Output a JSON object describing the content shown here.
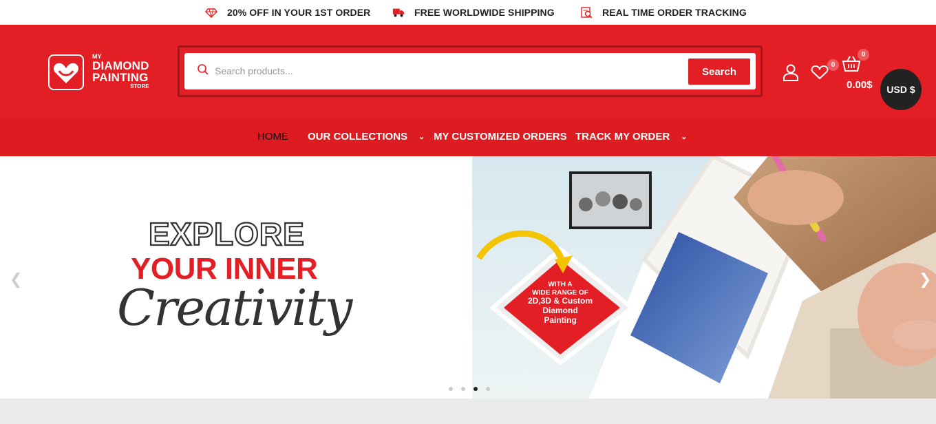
{
  "promos": [
    {
      "icon": "diamond-icon",
      "text": "20% OFF IN YOUR 1ST ORDER"
    },
    {
      "icon": "truck-icon",
      "text": "FREE WORLDWIDE SHIPPING"
    },
    {
      "icon": "tracking-icon",
      "text": "REAL TIME ORDER TRACKING"
    }
  ],
  "logo": {
    "line_my": "MY",
    "line1": "DIAMOND",
    "line2": "PAINTING",
    "line_store": "STORE"
  },
  "search": {
    "placeholder": "Search products...",
    "button_label": "Search"
  },
  "account": {
    "wishlist_count": "0",
    "cart_count": "0",
    "cart_total": "0.00$",
    "currency": "USD $"
  },
  "nav": {
    "items": [
      {
        "label": "HOME",
        "active": true
      },
      {
        "label": "OUR COLLECTIONS",
        "has_dropdown": true
      },
      {
        "label": "MY CUSTOMIZED ORDERS"
      },
      {
        "label": "TRACK MY ORDER",
        "has_dropdown": true
      }
    ]
  },
  "hero": {
    "headline1": "EXPLORE",
    "headline2": "YOUR INNER",
    "headline3": "Creativity",
    "badge": [
      "WITH A",
      "WIDE RANGE OF",
      "2D,3D & Custom",
      "Diamond",
      "Painting"
    ],
    "slide_count": 4,
    "active_slide": 3
  },
  "colors": {
    "brand_red": "#e31e24",
    "dark": "#222222"
  }
}
